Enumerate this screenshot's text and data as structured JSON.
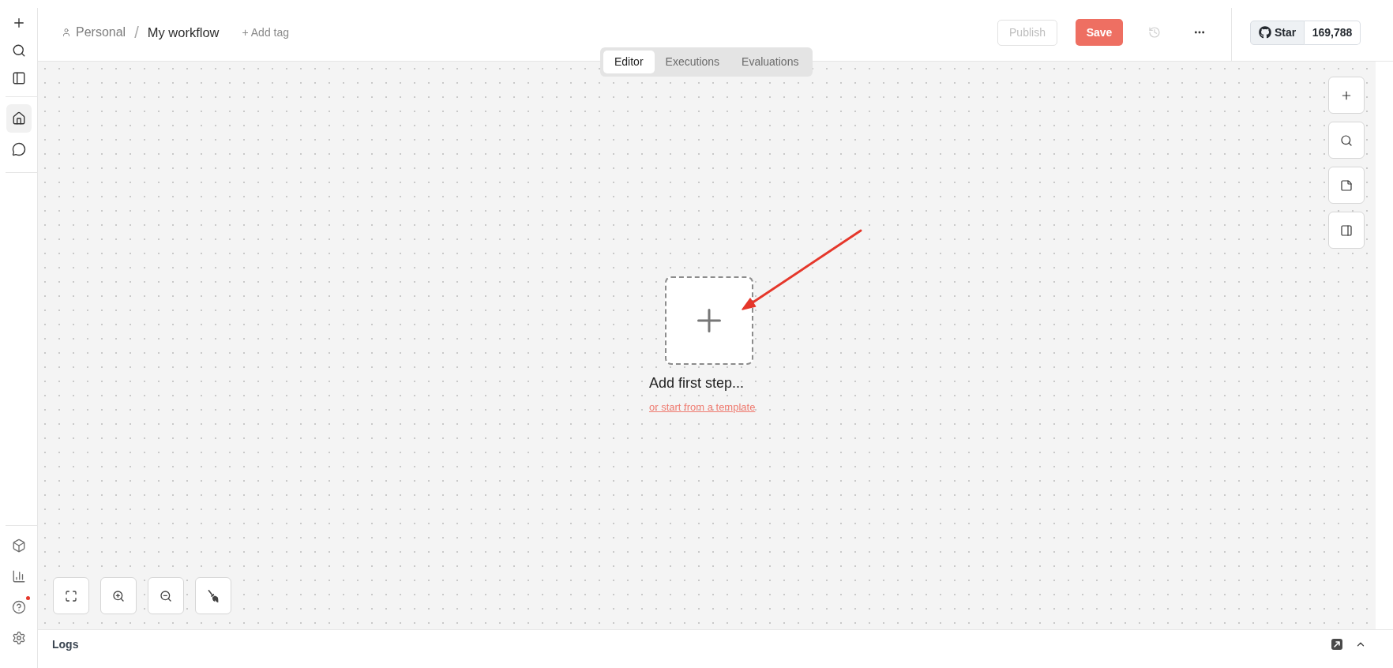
{
  "sidebar": {
    "top": [
      {
        "selected": false
      },
      {
        "selected": false
      },
      {
        "selected": false
      }
    ],
    "middle": [
      {
        "selected": true
      },
      {
        "selected": false
      }
    ],
    "bottom": [
      {
        "selected": false,
        "notification": false
      },
      {
        "selected": false,
        "notification": false
      },
      {
        "selected": false,
        "notification": true
      },
      {
        "selected": false,
        "notification": false
      }
    ]
  },
  "header": {
    "breadcrumb": {
      "project": "Personal",
      "separator": "/",
      "workflow": "My workflow"
    },
    "add_tag": "+ Add tag",
    "publish": {
      "label": "Publish",
      "disabled": true
    },
    "save": {
      "label": "Save"
    },
    "history": {
      "disabled": true
    },
    "github": {
      "label": "Star",
      "count": "169,788"
    }
  },
  "tabs": [
    {
      "label": "Editor",
      "selected": true
    },
    {
      "label": "Executions",
      "selected": false
    },
    {
      "label": "Evaluations",
      "selected": false
    }
  ],
  "canvas": {
    "empty_state": {
      "title": "Add first step...",
      "link": "or start from a template"
    }
  },
  "logs": {
    "title": "Logs"
  }
}
